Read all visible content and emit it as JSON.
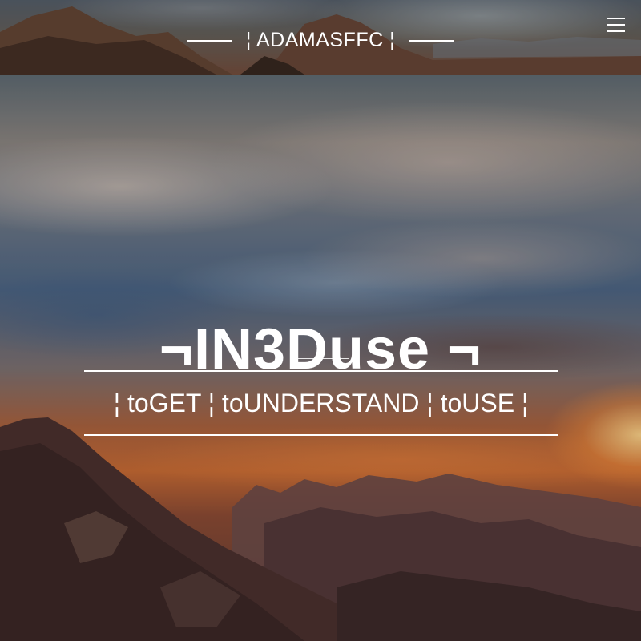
{
  "header": {
    "brand": "¦ ADAMASFFC ¦",
    "menu_icon": "hamburger-menu-icon"
  },
  "hero": {
    "title": "¬IN3Duse ¬",
    "tagline": "¦ toGET ¦  toUNDERSTAND  ¦ toUSE ¦"
  },
  "colors": {
    "text": "#ffffff",
    "sky_blue": "#4d6583",
    "sunset_orange": "#c66a34",
    "mountain_brown": "#5a3a34"
  }
}
